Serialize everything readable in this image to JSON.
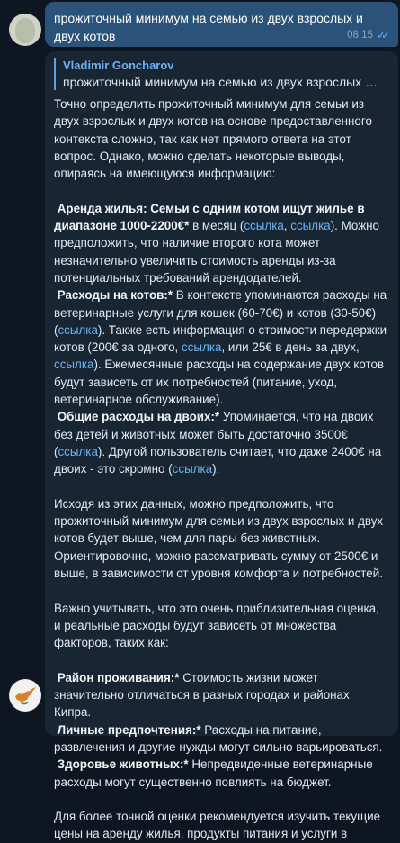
{
  "outgoing": {
    "text": "прожиточный минимум на семью из двух взрослых и двух котов",
    "time": "08:15"
  },
  "incoming": {
    "reply_name": "Vladimir Goncharov",
    "reply_quote": "прожиточный минимум на семью из двух взрослых и двух котов",
    "intro": "Точно определить прожиточный минимум для семьи из двух взрослых и двух котов на основе предоставленного контекста сложно, так как нет прямого ответа на этот вопрос. Однако, можно сделать некоторые выводы, опираясь на имеющуюся информацию:",
    "rent": {
      "bold": "Аренда жилья: Семьи с одним котом ищут жилье в диапазоне 1000-2200€*",
      "t1": " в месяц (",
      "l1": "ссылка",
      "t2": ", ",
      "l2": "ссылка",
      "t3": "). Можно предположить, что наличие второго кота может незначительно увеличить стоимость аренды из-за потенциальных требований арендодателей."
    },
    "cats": {
      "bold": "Расходы на котов:*",
      "t1": "  В контексте упоминаются расходы на ветеринарные услуги для кошек (60-70€) и котов (30-50€) (",
      "l1": "ссылка",
      "t2": "). Также есть информация о стоимости передержки котов (200€ за одного, ",
      "l2": "ссылка",
      "t3": ", или 25€ в день за двух, ",
      "l3": "ссылка",
      "t4": "). Ежемесячные расходы на содержание двух котов будут зависеть от их потребностей (питание, уход, ветеринарное обслуживание)."
    },
    "total": {
      "bold": "Общие расходы на двоих:*",
      "t1": "  Упоминается, что на двоих без детей и животных может быть достаточно 3500€ (",
      "l1": "ссылка",
      "t2": "). Другой пользователь считает, что даже 2400€ на двоих - это скромно (",
      "l2": "ссылка",
      "t3": ")."
    },
    "conclusion": "Исходя из этих данных, можно предположить, что прожиточный минимум для семьи из двух взрослых и двух котов будет выше, чем для пары без животных. Ориентировочно, можно рассматривать сумму от 2500€ и выше, в зависимости от уровня комфорта и потребностей.",
    "note": "Важно учитывать, что это очень приблизительная оценка, и реальные расходы будут зависеть от множества факторов, таких как:",
    "factor1": {
      "bold": "Район проживания:*",
      "text": "  Стоимость жизни может значительно отличаться в разных городах и районах Кипра."
    },
    "factor2": {
      "bold": "Личные предпочтения:*",
      "text": "  Расходы на питание, развлечения и другие нужды могут сильно варьироваться."
    },
    "factor3": {
      "bold": "Здоровье животных:*",
      "text": "  Непредвиденные ветеринарные расходы могут существенно повлиять на бюджет."
    },
    "closing": "Для более точной оценки рекомендуется изучить текущие цены на аренду жилья, продукты питания и услуги в"
  }
}
